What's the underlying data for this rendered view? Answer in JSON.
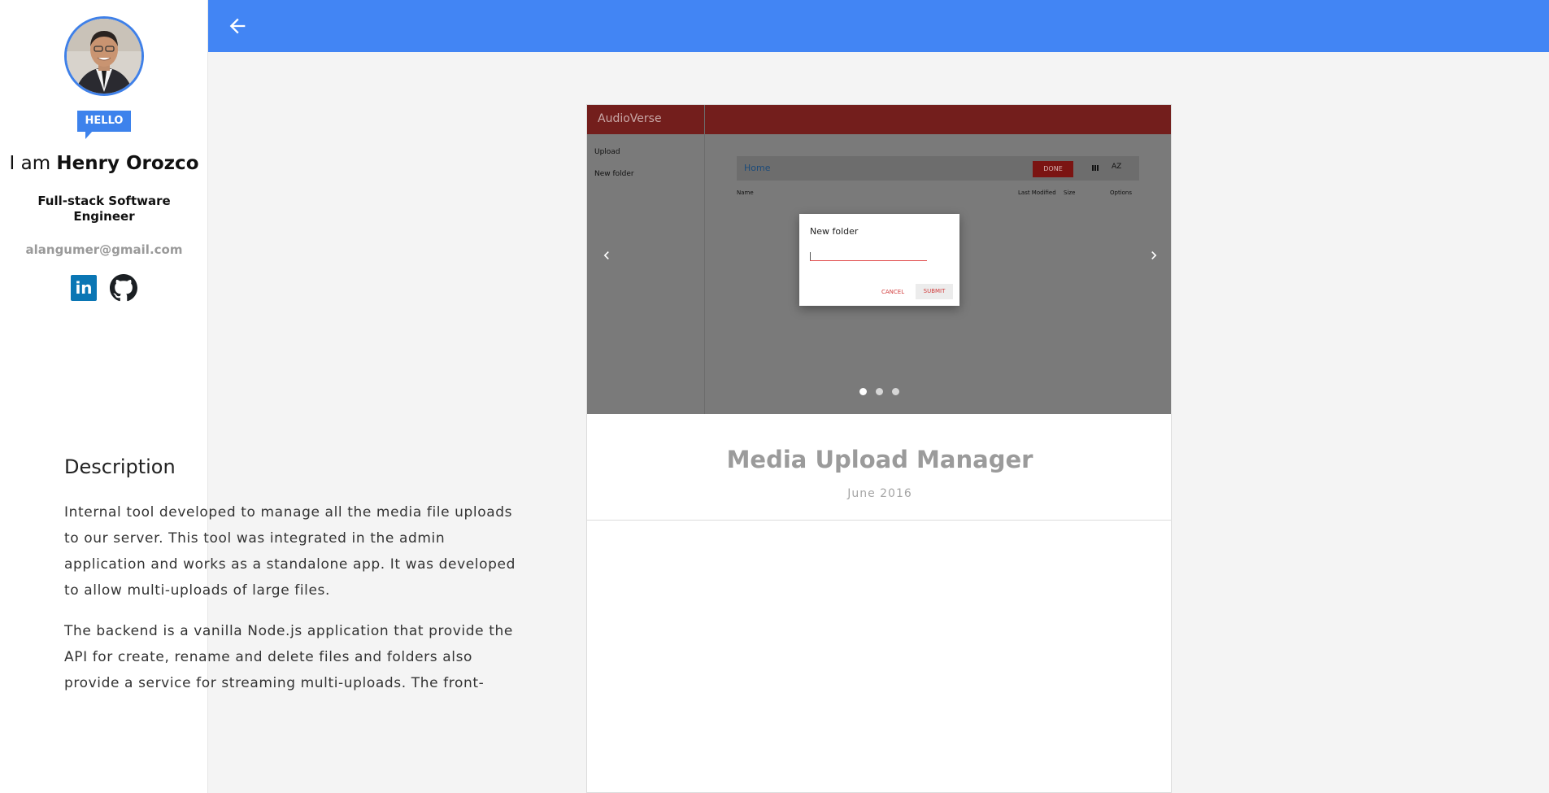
{
  "sidebar": {
    "greeting_prefix": "I am ",
    "name": "Henry Orozco",
    "hello_badge": "HELLO",
    "role": "Full-stack Software Engineer",
    "email": "alangumer@gmail.com",
    "social": [
      {
        "icon": "linkedin-icon",
        "label": "in"
      },
      {
        "icon": "github-icon"
      }
    ]
  },
  "header": {
    "back_icon": "arrow-left-icon",
    "color": "#4285f4"
  },
  "carousel": {
    "slide_count": 3,
    "active_slide": 1,
    "screenshot": {
      "brand": "AudioVerse",
      "side_items": [
        "Upload",
        "New folder"
      ],
      "breadcrumb": "Home",
      "done_label": "DONE",
      "sort_label": "AZ",
      "columns": [
        "Name",
        "Last Modified",
        "Size",
        "Options"
      ],
      "dialog": {
        "title": "New folder",
        "cancel": "CANCEL",
        "submit": "SUBMIT"
      }
    }
  },
  "project": {
    "title": "Media Upload Manager",
    "date": "June 2016",
    "description_heading": "Description",
    "paragraphs": [
      "Internal tool developed to manage all the media file uploads to our server. This tool was integrated in the admin application and works as a standalone app. It was developed to allow multi-uploads of large files.",
      "The backend is a vanilla Node.js application that provide the API for create, rename and delete files and folders also provide a service for streaming multi-uploads. The front-"
    ]
  },
  "colors": {
    "accent": "#4285f4",
    "badge": "#3d82ec",
    "screenshot_bar": "#731e1c"
  }
}
